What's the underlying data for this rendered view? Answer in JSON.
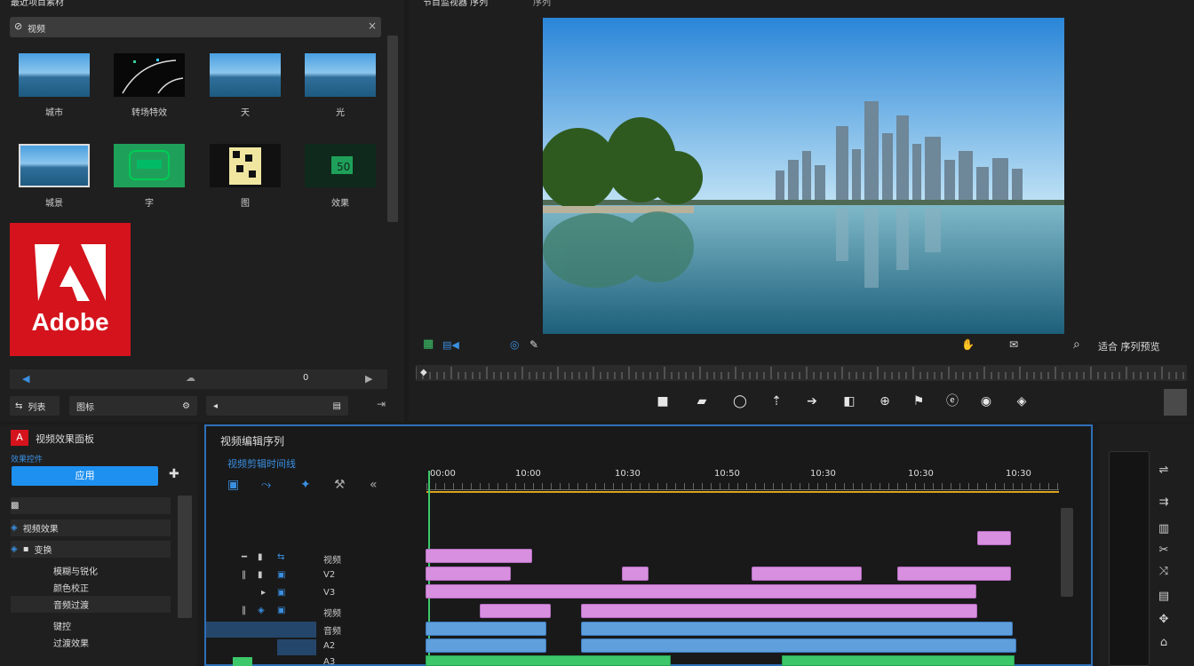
{
  "project": {
    "title": "最近项目素材",
    "search_value": "视频",
    "thumbs": [
      {
        "label": "城市"
      },
      {
        "label": "转场特效"
      },
      {
        "label": "天"
      },
      {
        "label": "光"
      },
      {
        "label": "城景"
      },
      {
        "label": "字"
      },
      {
        "label": "图"
      },
      {
        "label": "效果"
      }
    ],
    "logo_text": "Adobe",
    "nav_center": "0",
    "btn_list": "列表",
    "btn_icon": "图标"
  },
  "monitor": {
    "title": "节目监视器 序列",
    "subtitle": "序列",
    "tool_text": "适合 序列预览",
    "play_icons": [
      "camera-icon",
      "film-icon",
      "loop-icon",
      "trim-icon",
      "arrow-right-icon",
      "speaker-icon",
      "compass-icon",
      "marker-icon",
      "export-icon",
      "settings-icon",
      "navigation-icon"
    ]
  },
  "effects": {
    "title": "视频效果面板",
    "subtitle": "效果控件",
    "apply_label": "应用",
    "rows": [
      "视频效果",
      "变换",
      "模糊与锐化",
      "颜色校正",
      "音频过渡",
      "键控",
      "过渡效果"
    ]
  },
  "timeline": {
    "title": "视频编辑序列",
    "subtitle": "视频剪辑时间线",
    "timecodes": [
      "00:00",
      "10:00",
      "10:30",
      "10:50",
      "10:30",
      "10:30",
      "10:30"
    ],
    "tracks": [
      {
        "label": "视频"
      },
      {
        "label": "V2"
      },
      {
        "label": "V3"
      },
      {
        "label": "视频"
      },
      {
        "label": "音频"
      },
      {
        "label": "A2"
      },
      {
        "label": "A3"
      }
    ]
  },
  "colors": {
    "accent": "#2e6fb7",
    "clip_video": "#d98fe0",
    "clip_audio": "#5f9fdc",
    "clip_green": "#3cc86a",
    "adobe_red": "#d4131c"
  }
}
